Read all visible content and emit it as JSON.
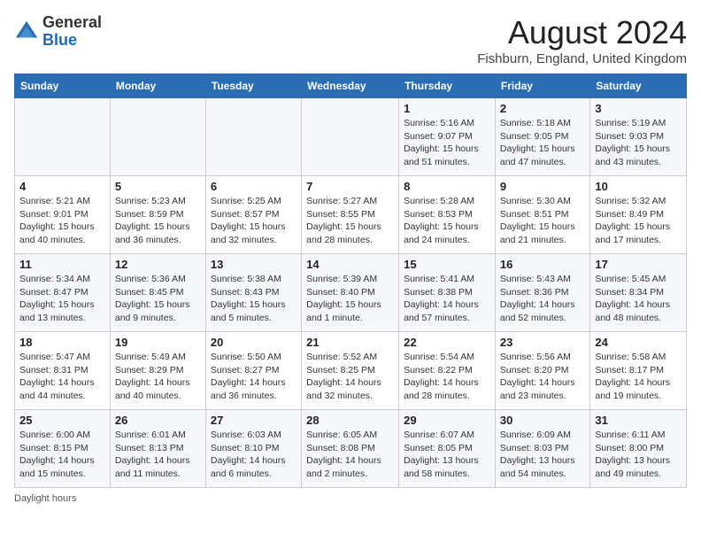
{
  "header": {
    "logo_general": "General",
    "logo_blue": "Blue",
    "month_year": "August 2024",
    "location": "Fishburn, England, United Kingdom"
  },
  "days_of_week": [
    "Sunday",
    "Monday",
    "Tuesday",
    "Wednesday",
    "Thursday",
    "Friday",
    "Saturday"
  ],
  "footer": {
    "daylight_hours": "Daylight hours"
  },
  "weeks": [
    [
      {
        "day": "",
        "sunrise": "",
        "sunset": "",
        "daylight": ""
      },
      {
        "day": "",
        "sunrise": "",
        "sunset": "",
        "daylight": ""
      },
      {
        "day": "",
        "sunrise": "",
        "sunset": "",
        "daylight": ""
      },
      {
        "day": "",
        "sunrise": "",
        "sunset": "",
        "daylight": ""
      },
      {
        "day": "1",
        "sunrise": "Sunrise: 5:16 AM",
        "sunset": "Sunset: 9:07 PM",
        "daylight": "Daylight: 15 hours and 51 minutes."
      },
      {
        "day": "2",
        "sunrise": "Sunrise: 5:18 AM",
        "sunset": "Sunset: 9:05 PM",
        "daylight": "Daylight: 15 hours and 47 minutes."
      },
      {
        "day": "3",
        "sunrise": "Sunrise: 5:19 AM",
        "sunset": "Sunset: 9:03 PM",
        "daylight": "Daylight: 15 hours and 43 minutes."
      }
    ],
    [
      {
        "day": "4",
        "sunrise": "Sunrise: 5:21 AM",
        "sunset": "Sunset: 9:01 PM",
        "daylight": "Daylight: 15 hours and 40 minutes."
      },
      {
        "day": "5",
        "sunrise": "Sunrise: 5:23 AM",
        "sunset": "Sunset: 8:59 PM",
        "daylight": "Daylight: 15 hours and 36 minutes."
      },
      {
        "day": "6",
        "sunrise": "Sunrise: 5:25 AM",
        "sunset": "Sunset: 8:57 PM",
        "daylight": "Daylight: 15 hours and 32 minutes."
      },
      {
        "day": "7",
        "sunrise": "Sunrise: 5:27 AM",
        "sunset": "Sunset: 8:55 PM",
        "daylight": "Daylight: 15 hours and 28 minutes."
      },
      {
        "day": "8",
        "sunrise": "Sunrise: 5:28 AM",
        "sunset": "Sunset: 8:53 PM",
        "daylight": "Daylight: 15 hours and 24 minutes."
      },
      {
        "day": "9",
        "sunrise": "Sunrise: 5:30 AM",
        "sunset": "Sunset: 8:51 PM",
        "daylight": "Daylight: 15 hours and 21 minutes."
      },
      {
        "day": "10",
        "sunrise": "Sunrise: 5:32 AM",
        "sunset": "Sunset: 8:49 PM",
        "daylight": "Daylight: 15 hours and 17 minutes."
      }
    ],
    [
      {
        "day": "11",
        "sunrise": "Sunrise: 5:34 AM",
        "sunset": "Sunset: 8:47 PM",
        "daylight": "Daylight: 15 hours and 13 minutes."
      },
      {
        "day": "12",
        "sunrise": "Sunrise: 5:36 AM",
        "sunset": "Sunset: 8:45 PM",
        "daylight": "Daylight: 15 hours and 9 minutes."
      },
      {
        "day": "13",
        "sunrise": "Sunrise: 5:38 AM",
        "sunset": "Sunset: 8:43 PM",
        "daylight": "Daylight: 15 hours and 5 minutes."
      },
      {
        "day": "14",
        "sunrise": "Sunrise: 5:39 AM",
        "sunset": "Sunset: 8:40 PM",
        "daylight": "Daylight: 15 hours and 1 minute."
      },
      {
        "day": "15",
        "sunrise": "Sunrise: 5:41 AM",
        "sunset": "Sunset: 8:38 PM",
        "daylight": "Daylight: 14 hours and 57 minutes."
      },
      {
        "day": "16",
        "sunrise": "Sunrise: 5:43 AM",
        "sunset": "Sunset: 8:36 PM",
        "daylight": "Daylight: 14 hours and 52 minutes."
      },
      {
        "day": "17",
        "sunrise": "Sunrise: 5:45 AM",
        "sunset": "Sunset: 8:34 PM",
        "daylight": "Daylight: 14 hours and 48 minutes."
      }
    ],
    [
      {
        "day": "18",
        "sunrise": "Sunrise: 5:47 AM",
        "sunset": "Sunset: 8:31 PM",
        "daylight": "Daylight: 14 hours and 44 minutes."
      },
      {
        "day": "19",
        "sunrise": "Sunrise: 5:49 AM",
        "sunset": "Sunset: 8:29 PM",
        "daylight": "Daylight: 14 hours and 40 minutes."
      },
      {
        "day": "20",
        "sunrise": "Sunrise: 5:50 AM",
        "sunset": "Sunset: 8:27 PM",
        "daylight": "Daylight: 14 hours and 36 minutes."
      },
      {
        "day": "21",
        "sunrise": "Sunrise: 5:52 AM",
        "sunset": "Sunset: 8:25 PM",
        "daylight": "Daylight: 14 hours and 32 minutes."
      },
      {
        "day": "22",
        "sunrise": "Sunrise: 5:54 AM",
        "sunset": "Sunset: 8:22 PM",
        "daylight": "Daylight: 14 hours and 28 minutes."
      },
      {
        "day": "23",
        "sunrise": "Sunrise: 5:56 AM",
        "sunset": "Sunset: 8:20 PM",
        "daylight": "Daylight: 14 hours and 23 minutes."
      },
      {
        "day": "24",
        "sunrise": "Sunrise: 5:58 AM",
        "sunset": "Sunset: 8:17 PM",
        "daylight": "Daylight: 14 hours and 19 minutes."
      }
    ],
    [
      {
        "day": "25",
        "sunrise": "Sunrise: 6:00 AM",
        "sunset": "Sunset: 8:15 PM",
        "daylight": "Daylight: 14 hours and 15 minutes."
      },
      {
        "day": "26",
        "sunrise": "Sunrise: 6:01 AM",
        "sunset": "Sunset: 8:13 PM",
        "daylight": "Daylight: 14 hours and 11 minutes."
      },
      {
        "day": "27",
        "sunrise": "Sunrise: 6:03 AM",
        "sunset": "Sunset: 8:10 PM",
        "daylight": "Daylight: 14 hours and 6 minutes."
      },
      {
        "day": "28",
        "sunrise": "Sunrise: 6:05 AM",
        "sunset": "Sunset: 8:08 PM",
        "daylight": "Daylight: 14 hours and 2 minutes."
      },
      {
        "day": "29",
        "sunrise": "Sunrise: 6:07 AM",
        "sunset": "Sunset: 8:05 PM",
        "daylight": "Daylight: 13 hours and 58 minutes."
      },
      {
        "day": "30",
        "sunrise": "Sunrise: 6:09 AM",
        "sunset": "Sunset: 8:03 PM",
        "daylight": "Daylight: 13 hours and 54 minutes."
      },
      {
        "day": "31",
        "sunrise": "Sunrise: 6:11 AM",
        "sunset": "Sunset: 8:00 PM",
        "daylight": "Daylight: 13 hours and 49 minutes."
      }
    ]
  ]
}
